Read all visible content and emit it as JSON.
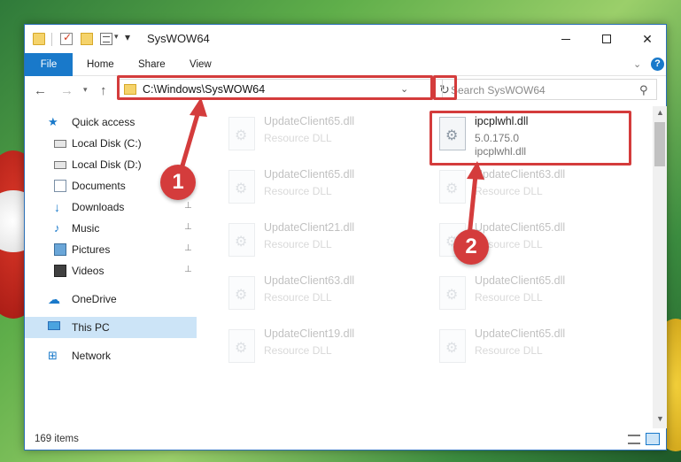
{
  "window": {
    "title": "SysWOW64",
    "minimize": "—",
    "close": "✕"
  },
  "quick_access_toolbar": {
    "dropdown_glyph": "▾",
    "customize_glyph": "▾"
  },
  "ribbon": {
    "tabs": [
      "File",
      "Home",
      "Share",
      "View"
    ],
    "expand_glyph": "⌄",
    "help": "?"
  },
  "nav_buttons": {
    "back": "←",
    "forward": "→",
    "recent": "▾",
    "up": "↑"
  },
  "address": {
    "path": "C:\\Windows\\SysWOW64",
    "dropdown_glyph": "⌄",
    "refresh_glyph": "↻"
  },
  "search": {
    "placeholder": "Search SysWOW64",
    "icon": "⚲"
  },
  "nav_pane": {
    "items": [
      {
        "label": "Quick access",
        "icon": "star-icon",
        "pinned": false
      },
      {
        "label": "Local Disk (C:)",
        "icon": "drive-icon",
        "pinned": false
      },
      {
        "label": "Local Disk (D:)",
        "icon": "drive-icon",
        "pinned": false
      },
      {
        "label": "Documents",
        "icon": "documents-icon",
        "pinned": true
      },
      {
        "label": "Downloads",
        "icon": "downloads-icon",
        "pinned": true
      },
      {
        "label": "Music",
        "icon": "music-icon",
        "pinned": true
      },
      {
        "label": "Pictures",
        "icon": "pictures-icon",
        "pinned": true
      },
      {
        "label": "Videos",
        "icon": "videos-icon",
        "pinned": true
      },
      {
        "label": "OneDrive",
        "icon": "onedrive-icon",
        "pinned": false
      },
      {
        "label": "This PC",
        "icon": "this-pc-icon",
        "pinned": false,
        "selected": true
      },
      {
        "label": "Network",
        "icon": "network-icon",
        "pinned": false
      }
    ],
    "pin_glyph": "📌"
  },
  "files": {
    "highlighted": {
      "name": "ipcplwhl.dll",
      "version": "5.0.175.0",
      "description": "ipcplwhl.dll"
    },
    "faded": [
      {
        "name": "UpdateClient65.dll",
        "type": "Resource DLL"
      },
      {
        "name": "UpdateClient65.dll",
        "type": "Resource DLL"
      },
      {
        "name": "UpdateClient63.dll",
        "type": "Resource DLL"
      },
      {
        "name": "UpdateClient21.dll",
        "type": "Resource DLL"
      },
      {
        "name": "UpdateClient65.dll",
        "type": "Resource DLL"
      },
      {
        "name": "UpdateClient63.dll",
        "type": "Resource DLL"
      },
      {
        "name": "UpdateClient65.dll",
        "type": "Resource DLL"
      },
      {
        "name": "UpdateClient19.dll",
        "type": "Resource DLL"
      },
      {
        "name": "UpdateClient65.dll",
        "type": "Resource DLL"
      }
    ]
  },
  "annotations": {
    "step1": "1",
    "step2": "2",
    "color": "#d43c3c"
  },
  "status": {
    "item_count": "169 items"
  },
  "colors": {
    "accent": "#1979ca",
    "selection": "#cce4f7",
    "highlight": "#d43c3c"
  }
}
